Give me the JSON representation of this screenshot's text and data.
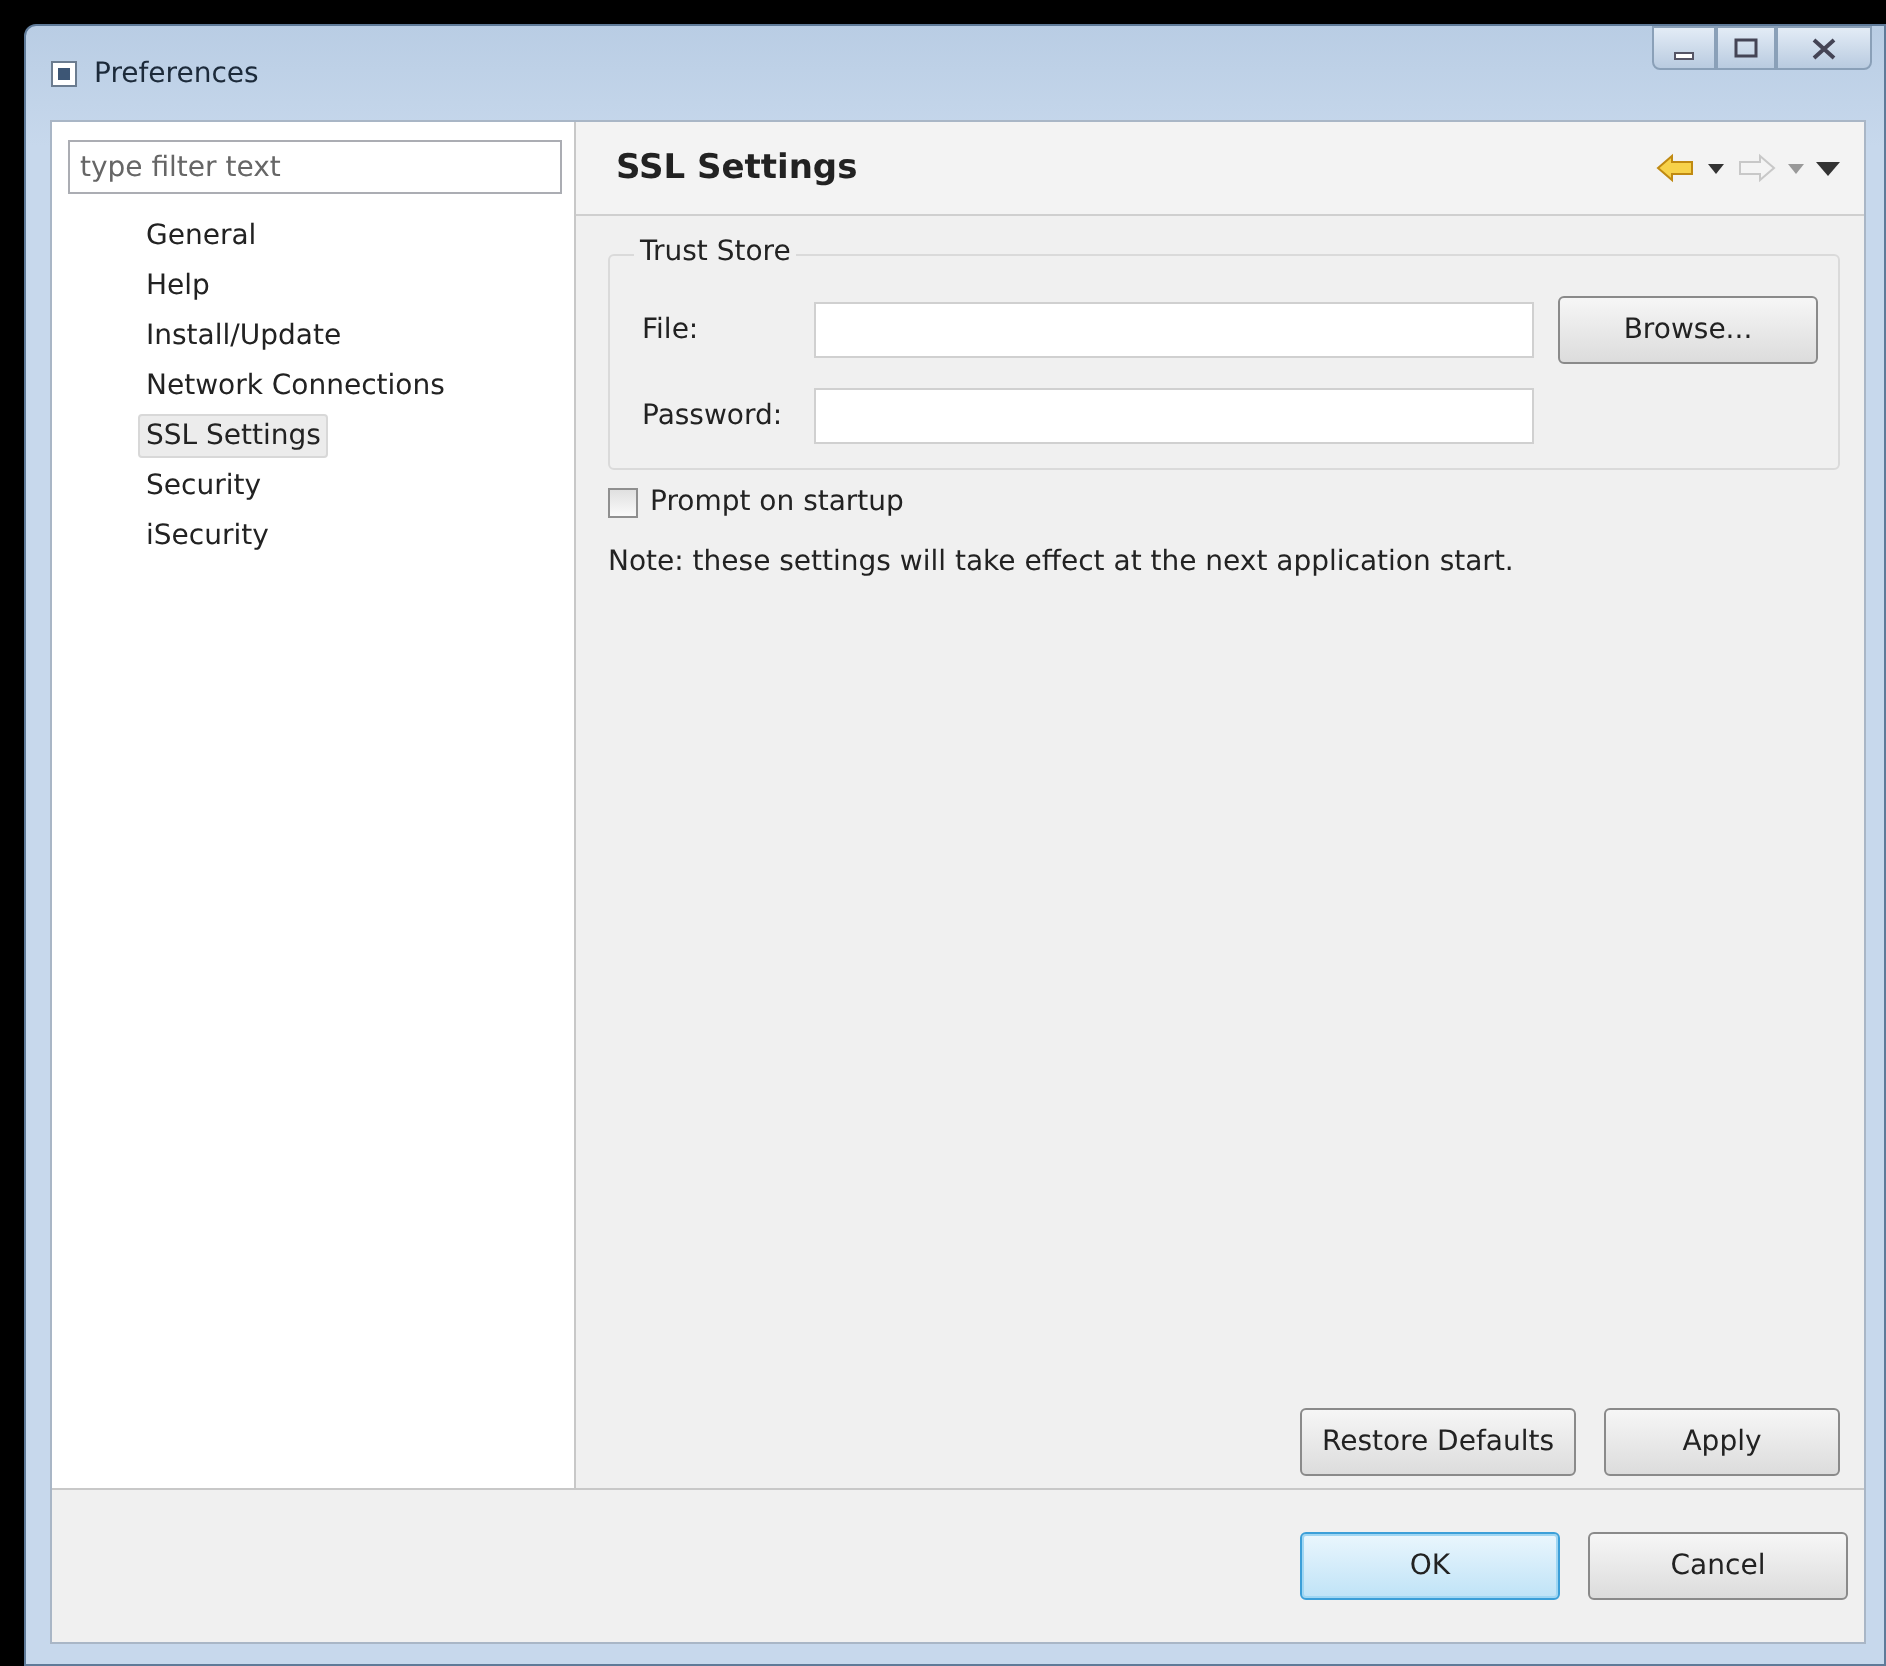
{
  "window": {
    "title": "Preferences"
  },
  "filter": {
    "placeholder": "type filter text"
  },
  "sidebar": {
    "items": [
      {
        "label": "General",
        "selected": false
      },
      {
        "label": "Help",
        "selected": false
      },
      {
        "label": "Install/Update",
        "selected": false
      },
      {
        "label": "Network Connections",
        "selected": false
      },
      {
        "label": "SSL Settings",
        "selected": true
      },
      {
        "label": "Security",
        "selected": false
      },
      {
        "label": "iSecurity",
        "selected": false
      }
    ]
  },
  "page": {
    "title": "SSL Settings",
    "group": {
      "title": "Trust Store",
      "fields": [
        {
          "label": "File:",
          "button": "Browse..."
        },
        {
          "label": "Password:"
        }
      ]
    },
    "checkbox": {
      "label": "Prompt on startup",
      "checked": false
    },
    "note": "Note: these settings will take effect at the next application start.",
    "buttons": [
      "Restore Defaults",
      "Apply"
    ]
  },
  "dialog_buttons": [
    {
      "label": "OK",
      "default": true
    },
    {
      "label": "Cancel",
      "default": false
    }
  ]
}
